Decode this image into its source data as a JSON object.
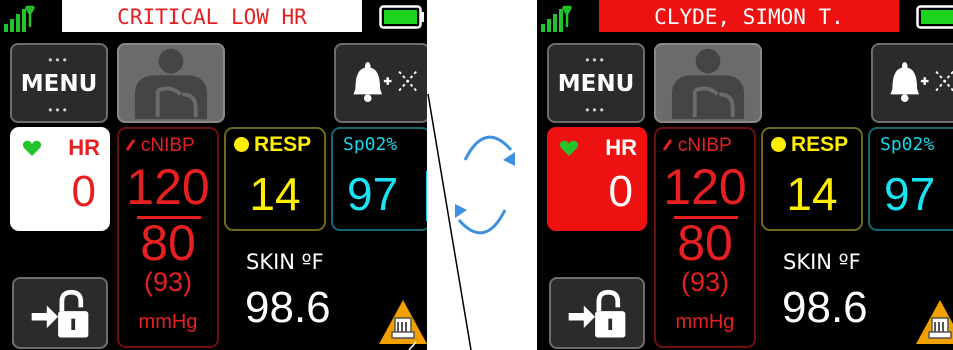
{
  "screens": [
    {
      "title": "CRITICAL LOW HR",
      "title_style": "white-bg",
      "menu_label": "MENU",
      "hr_label": "HR",
      "hr_value": "0",
      "nibp_label": "cNIBP",
      "nibp_systolic": "120",
      "nibp_diastolic": "80",
      "nibp_map": "(93)",
      "nibp_unit": "mmHg",
      "resp_label": "RESP",
      "resp_value": "14",
      "spo2_label": "Sp02%",
      "spo2_value": "97",
      "skin_label": "SKIN ºF",
      "skin_value": "98.6"
    },
    {
      "title": "CLYDE, SIMON T.",
      "title_style": "red-bg",
      "menu_label": "MENU",
      "hr_label": "HR",
      "hr_value": "0",
      "nibp_label": "cNIBP",
      "nibp_systolic": "120",
      "nibp_diastolic": "80",
      "nibp_map": "(93)",
      "nibp_unit": "mmHg",
      "resp_label": "RESP",
      "resp_value": "14",
      "spo2_label": "Sp02%",
      "spo2_value": "97",
      "skin_label": "SKIN ºF",
      "skin_value": "98.6"
    }
  ],
  "icons": {
    "signal": "signal-strength-icon",
    "battery": "battery-icon",
    "patient": "patient-torso-icon",
    "alarm": "alarm-bell-mute-icon",
    "lock": "unlock-exit-icon",
    "warning": "battery-warning-icon",
    "cycle": "cycle-arrows-icon"
  },
  "colors": {
    "hr_red": "#e62020",
    "resp_yellow": "#ffee00",
    "spo2_cyan": "#19e4f5",
    "heart_green": "#22c32b",
    "battery_green": "#1ed31e",
    "warning_orange": "#f2a000",
    "arrow_blue": "#3d8fe0"
  }
}
